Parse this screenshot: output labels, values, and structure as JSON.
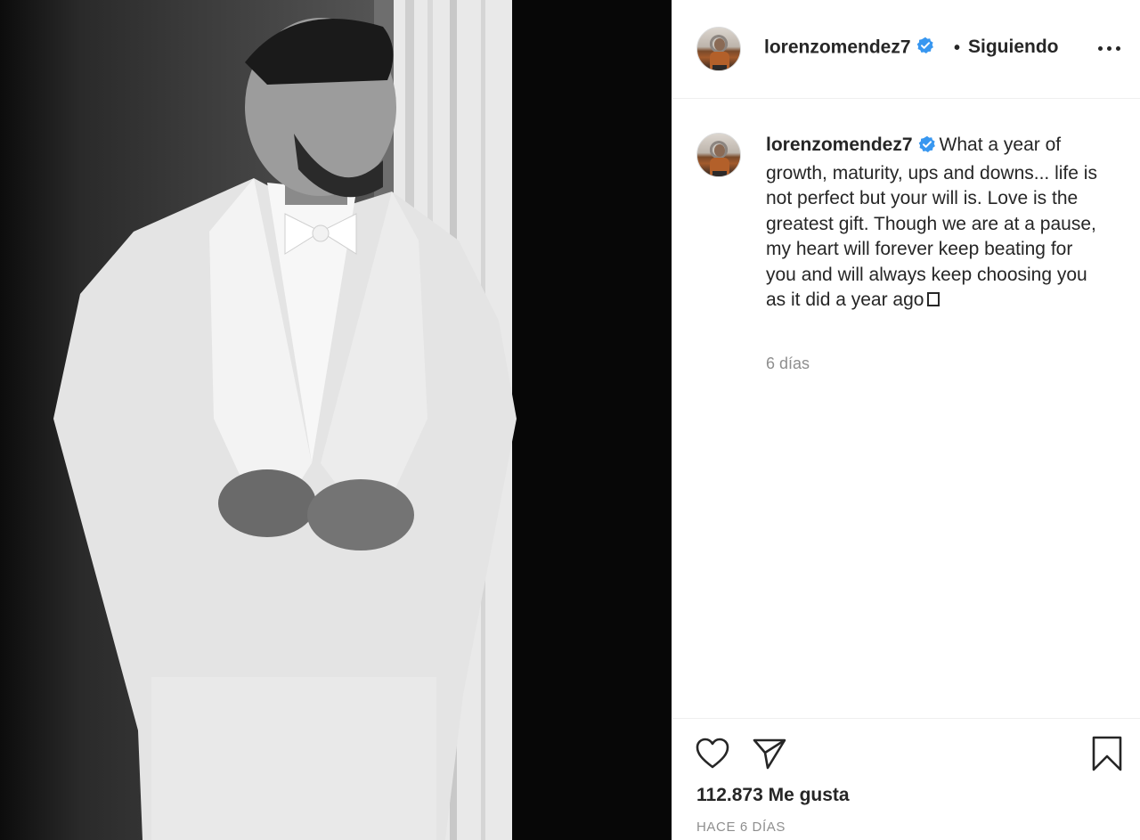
{
  "post": {
    "username": "lorenzomendez7",
    "follow_status": "Siguiendo",
    "follow_separator": "•",
    "caption": "What a year of growth, maturity, ups and downs... life is not perfect but your will is. Love is the greatest gift. Though we are at a pause, my heart will forever keep beating for you and will always keep choosing you as it did a year ago",
    "time_ago": "6 días",
    "likes": "112.873 Me gusta",
    "date": "HACE 6 DÍAS"
  },
  "icons": {
    "more": "more-options-icon",
    "verified": "verified-badge-icon",
    "like": "heart-icon",
    "share": "paper-plane-icon",
    "save": "bookmark-icon"
  },
  "colors": {
    "verified_blue": "#3897f0",
    "text": "#262626",
    "muted": "#8e8e8e"
  }
}
